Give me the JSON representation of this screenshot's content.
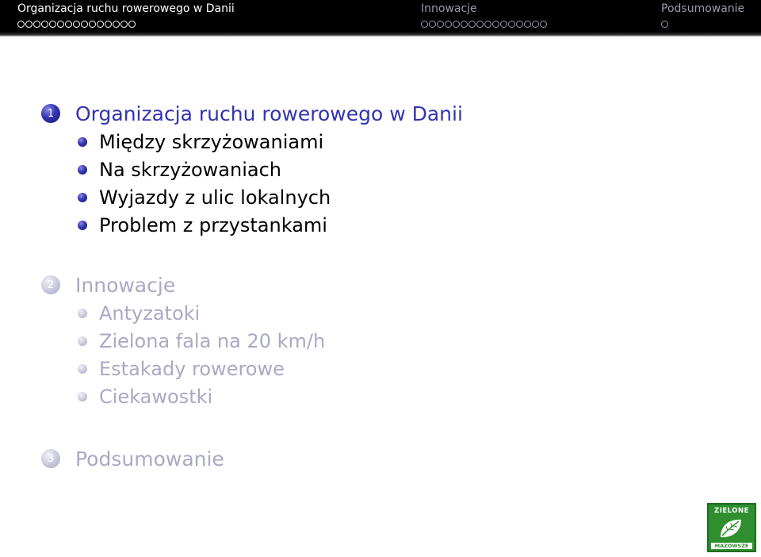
{
  "nav": {
    "sections": [
      {
        "title": "Organizacja ruchu rowerowego w Danii",
        "dots": 15,
        "active": true
      },
      {
        "title": "Innowacje",
        "dots": 16,
        "active": false
      },
      {
        "title": "Podsumowanie",
        "dots": 1,
        "active": false
      }
    ]
  },
  "toc": {
    "sections": [
      {
        "number": "1",
        "title": "Organizacja ruchu rowerowego w Danii",
        "active": true,
        "items": [
          "Między skrzyżowaniami",
          "Na skrzyżowaniach",
          "Wyjazdy z ulic lokalnych",
          "Problem z przystankami"
        ]
      },
      {
        "number": "2",
        "title": "Innowacje",
        "active": false,
        "items": [
          "Antyzatoki",
          "Zielona fala na 20 km/h",
          "Estakady rowerowe",
          "Ciekawostki"
        ]
      },
      {
        "number": "3",
        "title": "Podsumowanie",
        "active": false,
        "items": []
      }
    ]
  },
  "logo": {
    "top_text": "ZIELONE",
    "bottom_text": "MAZOWSZE"
  },
  "colors": {
    "accent": "#3333b3",
    "dimmed": "#a9a9c4",
    "nav_bg": "#000000",
    "logo_green": "#2f8f2f"
  }
}
